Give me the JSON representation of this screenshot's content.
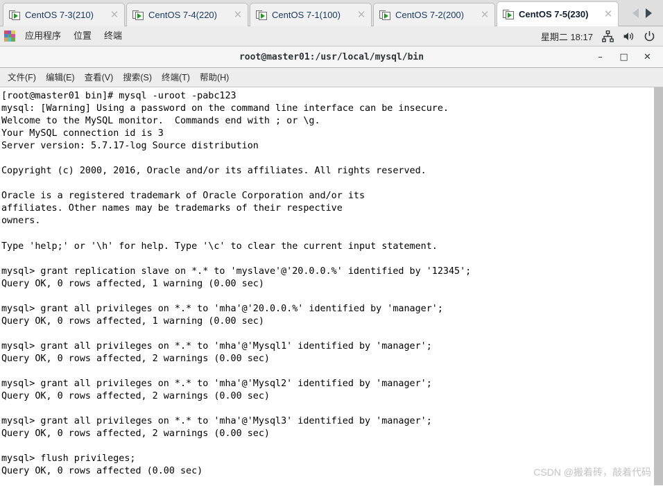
{
  "tab_bar": {
    "tabs": [
      {
        "label": "CentOS 7-3(210)",
        "close": "✕",
        "active": false
      },
      {
        "label": "CentOS 7-4(220)",
        "close": "✕",
        "active": false
      },
      {
        "label": "CentOS 7-1(100)",
        "close": "✕",
        "active": false
      },
      {
        "label": "CentOS 7-2(200)",
        "close": "✕",
        "active": false
      },
      {
        "label": "CentOS 7-5(230)",
        "close": "✕",
        "active": true
      }
    ],
    "nav_prev": "prev-tab-arrow",
    "nav_next": "next-tab-arrow"
  },
  "gnome_panel": {
    "apps_label": "应用程序",
    "places_label": "位置",
    "terminal_label": "终端",
    "clock": "星期二 18:17",
    "icons": [
      "network-icon",
      "volume-icon",
      "power-icon"
    ]
  },
  "terminal_window": {
    "title": "root@master01:/usr/local/mysql/bin",
    "window_buttons": {
      "minimize": "–",
      "maximize": "□",
      "close": "✕"
    },
    "menus": [
      "文件(F)",
      "编辑(E)",
      "查看(V)",
      "搜索(S)",
      "终端(T)",
      "帮助(H)"
    ],
    "content": "[root@master01 bin]# mysql -uroot -pabc123\nmysql: [Warning] Using a password on the command line interface can be insecure.\nWelcome to the MySQL monitor.  Commands end with ; or \\g.\nYour MySQL connection id is 3\nServer version: 5.7.17-log Source distribution\n\nCopyright (c) 2000, 2016, Oracle and/or its affiliates. All rights reserved.\n\nOracle is a registered trademark of Oracle Corporation and/or its\naffiliates. Other names may be trademarks of their respective\nowners.\n\nType 'help;' or '\\h' for help. Type '\\c' to clear the current input statement.\n\nmysql> grant replication slave on *.* to 'myslave'@'20.0.0.%' identified by '12345';\nQuery OK, 0 rows affected, 1 warning (0.00 sec)\n\nmysql> grant all privileges on *.* to 'mha'@'20.0.0.%' identified by 'manager';\nQuery OK, 0 rows affected, 1 warning (0.00 sec)\n\nmysql> grant all privileges on *.* to 'mha'@'Mysql1' identified by 'manager';\nQuery OK, 0 rows affected, 2 warnings (0.00 sec)\n\nmysql> grant all privileges on *.* to 'mha'@'Mysql2' identified by 'manager';\nQuery OK, 0 rows affected, 2 warnings (0.00 sec)\n\nmysql> grant all privileges on *.* to 'mha'@'Mysql3' identified by 'manager';\nQuery OK, 0 rows affected, 2 warnings (0.00 sec)\n\nmysql> flush privileges;\nQuery OK, 0 rows affected (0.00 sec)"
  },
  "watermark": "CSDN @搬着砖，敲着代码",
  "colors": {
    "tab_bar_bg": "#dfdfdf",
    "panel_bg": "#ebebeb",
    "titlebar_bg": "#f5f5f5",
    "terminal_bg": "#ffffff",
    "terminal_fg": "#000000",
    "scrollbar": "#c0c0c0",
    "tab_label": "#1a3a63",
    "play_green": "#1f9a1f",
    "watermark": "#c3c3c3"
  }
}
